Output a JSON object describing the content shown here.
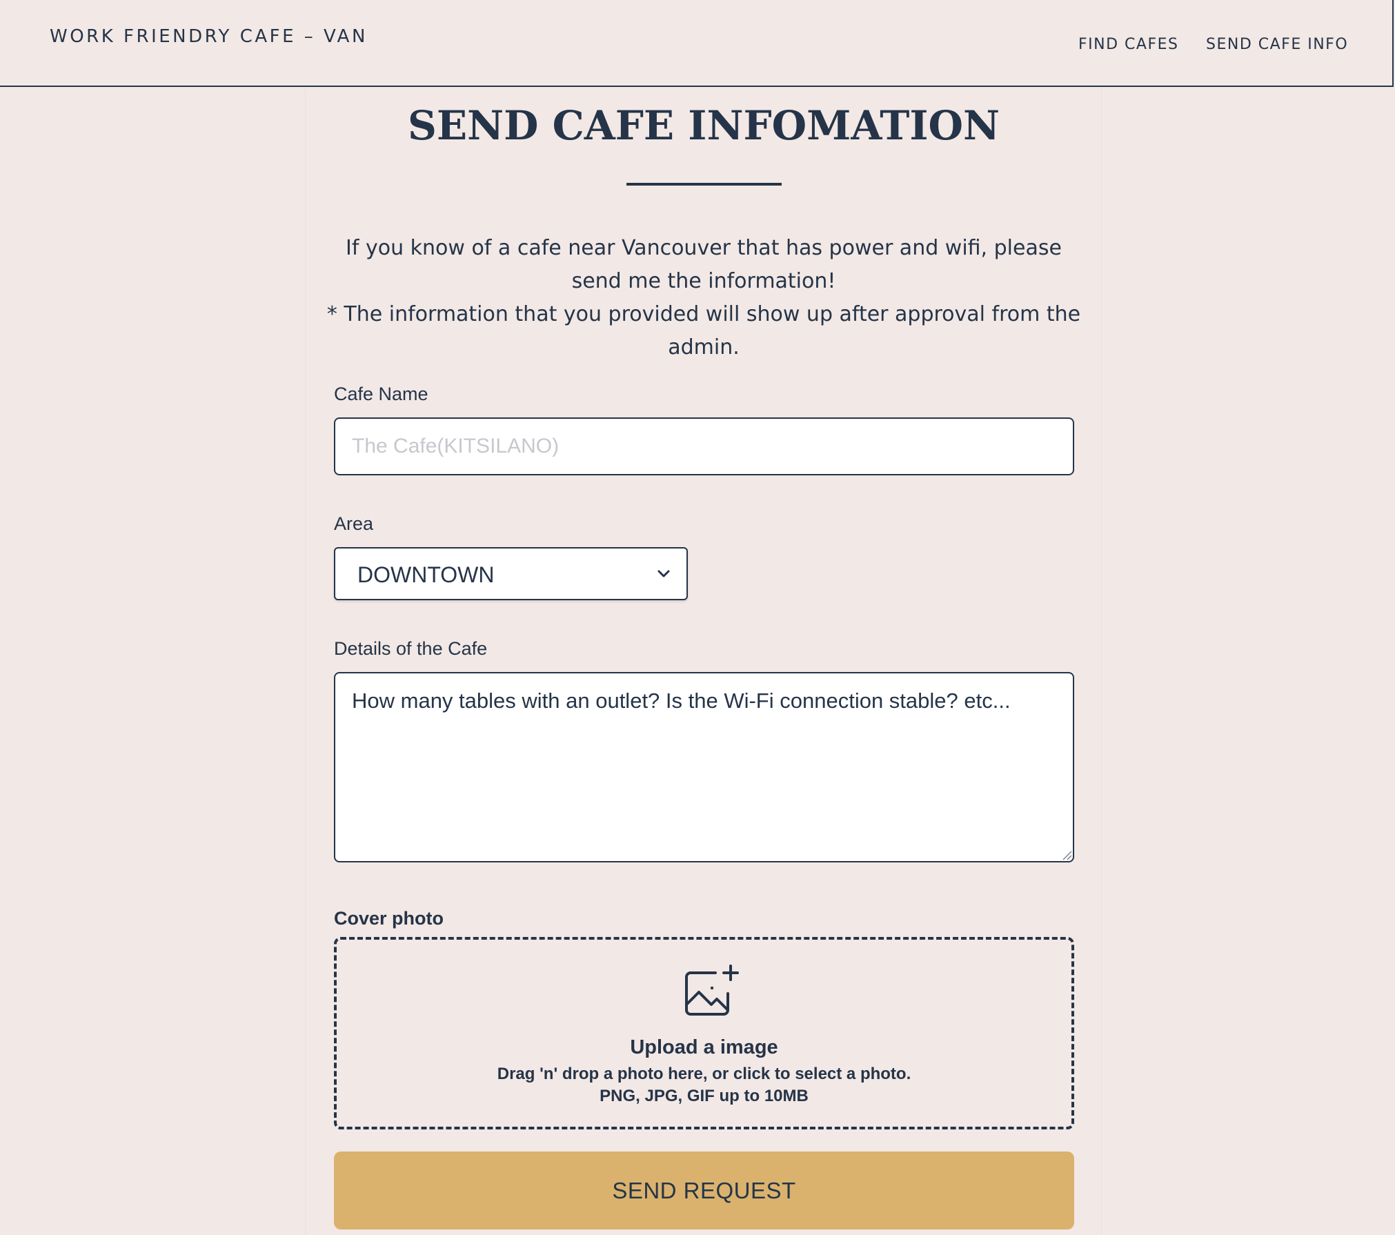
{
  "navbar": {
    "brand": "WORK FRIENDRY CAFE – VAN",
    "links": [
      {
        "label": "FIND CAFES"
      },
      {
        "label": "SEND CAFE INFO"
      }
    ]
  },
  "page": {
    "title": "SEND CAFE INFOMATION",
    "intro_line_1": "If you know of a cafe near Vancouver that has power and wifi, please send me the information!",
    "intro_line_2": "* The information that you provided will show up after approval from the admin."
  },
  "form": {
    "cafe_name": {
      "label": "Cafe Name",
      "value": "",
      "placeholder": "The Cafe(KITSILANO)"
    },
    "area": {
      "label": "Area",
      "selected": "DOWNTOWN"
    },
    "details": {
      "label": "Details of the Cafe",
      "value": "",
      "placeholder": "How many tables with an outlet? Is the Wi-Fi connection stable? etc..."
    },
    "cover_photo": {
      "label": "Cover photo",
      "title": "Upload a image",
      "hint": "Drag 'n' drop a photo here, or click to select a photo.",
      "types": "PNG, JPG, GIF up to 10MB",
      "icon": "image-plus-icon"
    },
    "submit_label": "SEND REQUEST"
  },
  "colors": {
    "background": "#f2e8e5",
    "text": "#253448",
    "accent_button": "#dab26d",
    "field_background": "#ffffff"
  }
}
